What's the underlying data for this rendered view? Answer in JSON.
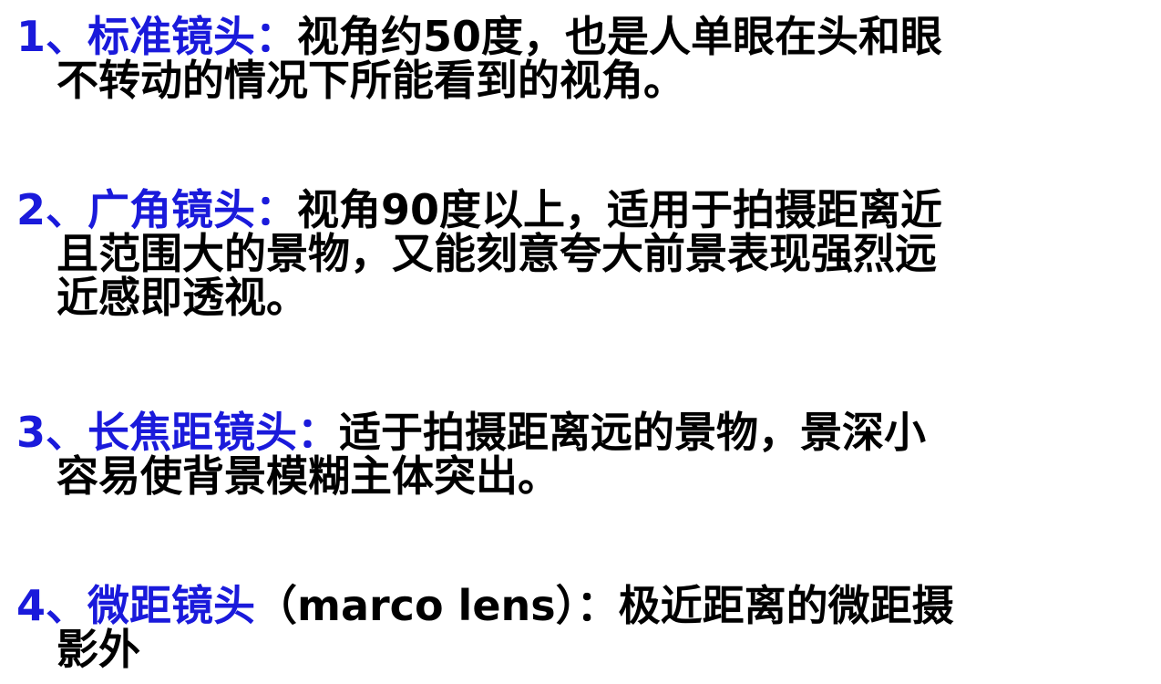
{
  "items": [
    {
      "number": "1、",
      "term": "标准镜头：",
      "lines": [
        "视角约50度，也是人单眼在头和眼",
        "不转动的情况下所能看到的视角。"
      ]
    },
    {
      "number": "2、",
      "term": "广角镜头：",
      "lines": [
        "视角90度以上，适用于拍摄距离近",
        "且范围大的景物，又能刻意夸大前景表现强烈远",
        "近感即透视。"
      ]
    },
    {
      "number": "3、",
      "term": "长焦距镜头：",
      "lines": [
        "适于拍摄距离远的景物，景深小",
        "容易使背景模糊主体突出。"
      ]
    },
    {
      "number": "4、",
      "term": "微距镜头",
      "lines": [
        "（marco lens）：极近距离的微距摄",
        "影外"
      ]
    }
  ],
  "colors": {
    "term": "#1a1adb",
    "body": "#000000",
    "background": "#ffffff"
  }
}
